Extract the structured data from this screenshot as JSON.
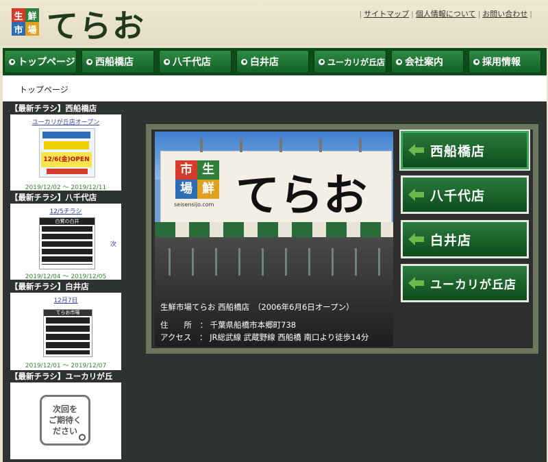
{
  "header": {
    "logo_chars": [
      "生",
      "鮮",
      "市",
      "場"
    ],
    "logo_colors": [
      "#d63a2a",
      "#2d7f3a",
      "#2c6db3",
      "#e0a020"
    ],
    "logo_text": "てらお",
    "util_links": [
      "サイトマップ",
      "個人情報について",
      "お問い合わせ"
    ]
  },
  "nav": {
    "tabs": [
      "トップページ",
      "西船橋店",
      "八千代店",
      "白井店",
      "ユーカリが丘店",
      "会社案内",
      "採用情報"
    ]
  },
  "breadcrumb": "トップページ",
  "sidebar": {
    "sections": [
      {
        "title": "【最新チラシ】西船橋店",
        "link": "ユーカリが丘店オープン",
        "date": "2019/12/02 ～ 2019/12/11"
      },
      {
        "title": "【最新チラシ】八千代店",
        "link": "12/5チラシ",
        "date": "2019/12/04 ～ 2019/12/05",
        "next": "次"
      },
      {
        "title": "【最新チラシ】白井店",
        "link": "12月7日",
        "date": "2019/12/01 ～ 2019/12/07"
      },
      {
        "title": "【最新チラシ】ユーカリが丘",
        "placeholder": "次回を\nご期待く\nださい"
      }
    ]
  },
  "feature": {
    "caption_title": "生鮮市場てらお 西船橋店　（2006年6月6日オープン）",
    "address_label": "住　　所　：",
    "address_value": "千葉県船橋市本郷町738",
    "access_label": "アクセス　：",
    "access_value": "JR総武線 武蔵野線 西船橋 南口より徒歩14分",
    "sign_chars": [
      "市",
      "生",
      "場",
      "鮮"
    ],
    "sign_text": "てらお",
    "sign_url": "seisensijo.com",
    "flyer1_banner": "12/6(金)OPEN",
    "flyer2_header": "白鷺の白井",
    "flyer3_header": "てらお市場"
  },
  "store_buttons": [
    "西船橋店",
    "八千代店",
    "白井店",
    "ユーカリが丘店"
  ]
}
